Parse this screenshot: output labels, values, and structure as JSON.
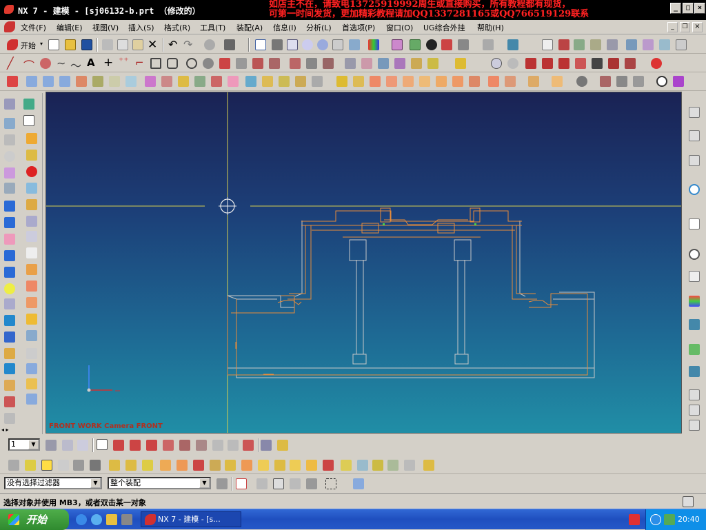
{
  "title": {
    "text": "NX 7 - 建模 - [sj06132-b.prt （修改的）",
    "watermark_line1": "如店主不在，请致电13725919992周生或直接购买，所有教程都有现货，",
    "watermark_line2": "可第一时间发货，更加精彩教程请加QQ1337281165或QQ766519129联系"
  },
  "menu": [
    "文件(F)",
    "编辑(E)",
    "视图(V)",
    "插入(S)",
    "格式(R)",
    "工具(T)",
    "装配(A)",
    "信息(I)",
    "分析(L)",
    "首选项(P)",
    "窗口(O)",
    "UG综合外挂",
    "帮助(H)"
  ],
  "toolbar": {
    "start_label": "开始"
  },
  "viewport": {
    "label": "FRONT WORK Camera FRONT"
  },
  "layer_combo": "1",
  "filter": {
    "selection_filter": "没有选择过滤器",
    "assembly_scope": "整个装配"
  },
  "status": {
    "message": "选择对象并使用 MB3，或者双击某一对象"
  },
  "taskbar": {
    "start": "开始",
    "task_label": "NX 7 - 建模 - [s...",
    "clock": "20:40"
  },
  "colors": {
    "accent": "#ff2222",
    "wire_orange": "#e88c3a",
    "wire_gray": "#c8c8c8",
    "crosshair": "#d8d050"
  }
}
